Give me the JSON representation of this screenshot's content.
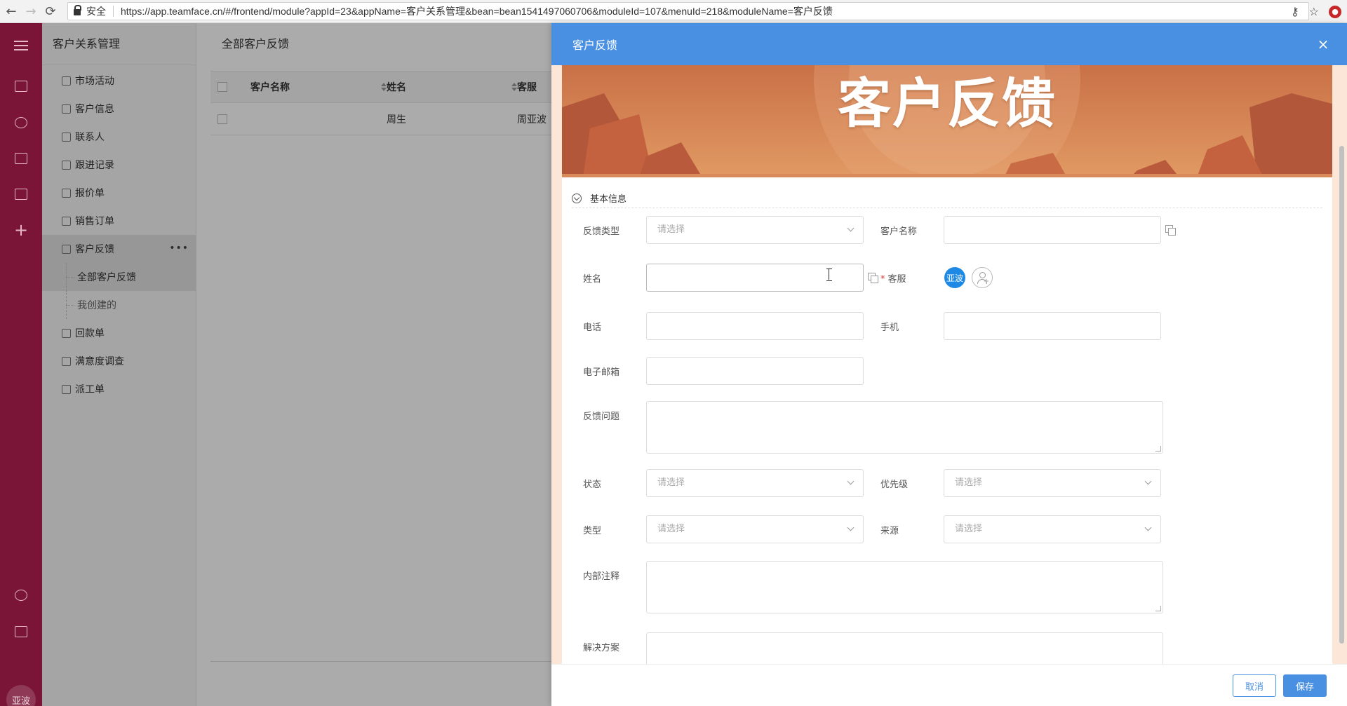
{
  "browser": {
    "secure_label": "安全",
    "url": "https://app.teamface.cn/#/frontend/module?appId=23&appName=客户关系管理&bean=bean1541497060706&moduleId=107&menuId=218&moduleName=客户反馈"
  },
  "rail": {
    "avatar_text": "亚波"
  },
  "sidebar": {
    "title": "客户关系管理",
    "items": [
      {
        "label": "市场活动"
      },
      {
        "label": "客户信息"
      },
      {
        "label": "联系人"
      },
      {
        "label": "跟进记录"
      },
      {
        "label": "报价单"
      },
      {
        "label": "销售订单"
      },
      {
        "label": "客户反馈"
      },
      {
        "label": "回款单"
      },
      {
        "label": "满意度调查"
      },
      {
        "label": "派工单"
      }
    ],
    "subitems": [
      {
        "label": "全部客户反馈"
      },
      {
        "label": "我创建的"
      }
    ],
    "more_label": "•••"
  },
  "main": {
    "title": "全部客户反馈",
    "columns": [
      "客户名称",
      "姓名",
      "客服"
    ],
    "rows": [
      {
        "name": "周生",
        "service": "周亚波"
      }
    ]
  },
  "drawer": {
    "title": "客户反馈",
    "close": "×",
    "banner_title": "客户反馈",
    "section_title": "基本信息",
    "fields": {
      "feedback_type": {
        "label": "反馈类型",
        "placeholder": "请选择"
      },
      "customer_name": {
        "label": "客户名称"
      },
      "name": {
        "label": "姓名"
      },
      "service": {
        "label": "客服",
        "required_mark": "*",
        "avatar": "亚波"
      },
      "phone": {
        "label": "电话"
      },
      "mobile": {
        "label": "手机"
      },
      "email": {
        "label": "电子邮箱"
      },
      "issue": {
        "label": "反馈问题"
      },
      "status": {
        "label": "状态",
        "placeholder": "请选择"
      },
      "priority": {
        "label": "优先级",
        "placeholder": "请选择"
      },
      "category": {
        "label": "类型",
        "placeholder": "请选择"
      },
      "source": {
        "label": "来源",
        "placeholder": "请选择"
      },
      "notes": {
        "label": "内部注释"
      },
      "solution": {
        "label": "解决方案"
      }
    },
    "cancel_label": "取消",
    "save_label": "保存"
  },
  "colors": {
    "rail": "#7a1537",
    "accent": "#4a90e2",
    "banner": "#d5824f",
    "drawer_bg": "#fbe6d8"
  }
}
